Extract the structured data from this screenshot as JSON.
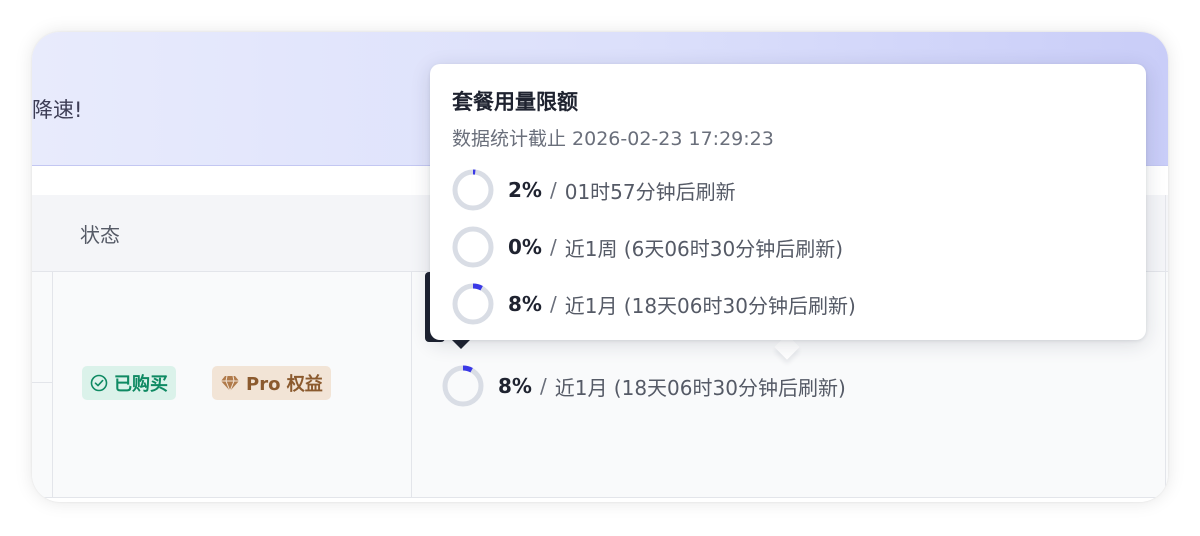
{
  "banner": {
    "text": "降速!"
  },
  "table": {
    "status_header": "状态"
  },
  "row": {
    "badges": {
      "purchased": "已购买",
      "pro": "Pro 权益"
    },
    "usage": {
      "percent": "8%",
      "separator": "/",
      "detail": "近1月 (18天06时30分钟后刷新)",
      "fraction": 0.08
    }
  },
  "popover": {
    "title": "套餐用量限额",
    "subtitle": "数据统计截止 2026-02-23 17:29:23",
    "items": [
      {
        "percent": "2%",
        "separator": "/",
        "detail": "01时57分钟后刷新",
        "fraction": 0.02
      },
      {
        "percent": "0%",
        "separator": "/",
        "detail": "近1周 (6天06时30分钟后刷新)",
        "fraction": 0.0
      },
      {
        "percent": "8%",
        "separator": "/",
        "detail": "近1月 (18天06时30分钟后刷新)",
        "fraction": 0.08
      }
    ]
  },
  "colors": {
    "ring_track": "#d9dde5",
    "ring_fill": "#3a39e6",
    "purchased_green": "#0f8a63",
    "pro_brown": "#8b5a2e"
  }
}
